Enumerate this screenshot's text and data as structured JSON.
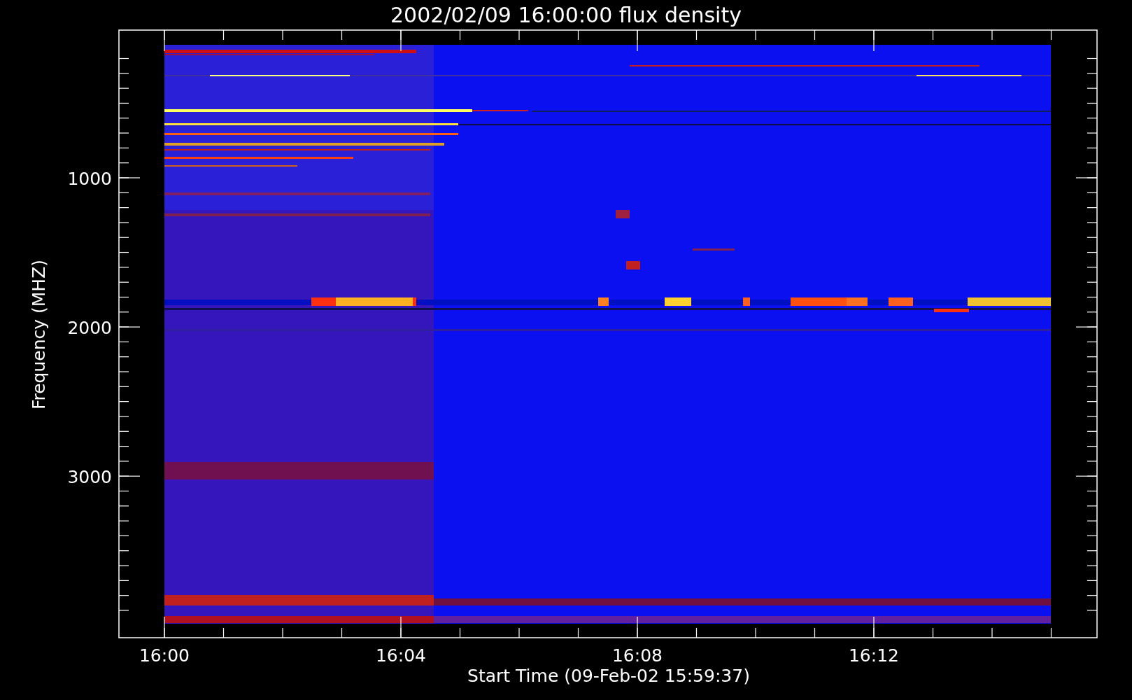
{
  "title": "2002/02/09 16:00:00 flux density",
  "y_axis": {
    "label": "Frequency (MHZ)",
    "ticks": [
      "1000",
      "2000",
      "3000"
    ]
  },
  "x_axis": {
    "label": "Start Time (09-Feb-02 15:59:37)",
    "ticks": [
      "16:00",
      "16:04",
      "16:08",
      "16:12"
    ]
  }
}
